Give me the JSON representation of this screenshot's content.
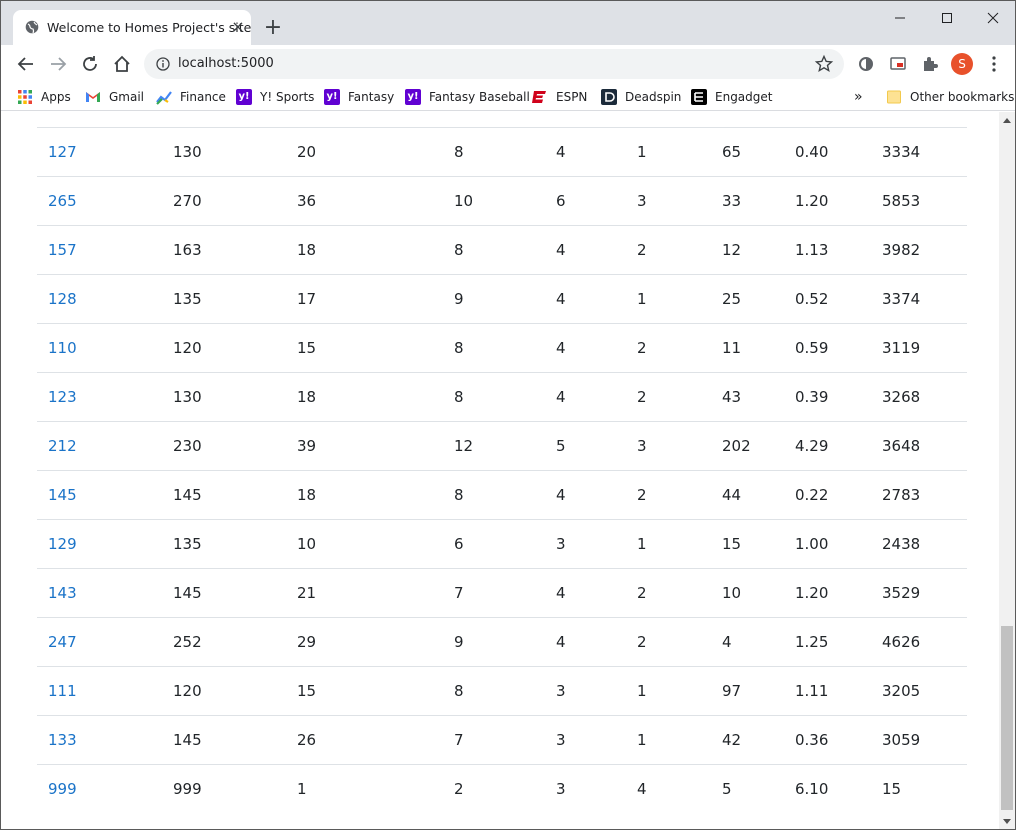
{
  "browser": {
    "tab_title": "Welcome to Homes Project's site",
    "url": "localhost:5000",
    "profile_initial": "S",
    "accent_color": "#1a73c8",
    "bookmarks": [
      {
        "label": "Apps",
        "icon": "apps-grid-icon"
      },
      {
        "label": "Gmail",
        "icon": "gmail-icon"
      },
      {
        "label": "Finance",
        "icon": "finance-icon"
      },
      {
        "label": "Y! Sports",
        "icon": "yahoo-icon"
      },
      {
        "label": "Fantasy",
        "icon": "yahoo-icon"
      },
      {
        "label": "Fantasy Baseball",
        "icon": "yahoo-icon"
      },
      {
        "label": "ESPN",
        "icon": "espn-icon"
      },
      {
        "label": "Deadspin",
        "icon": "deadspin-icon"
      },
      {
        "label": "Engadget",
        "icon": "engadget-icon"
      }
    ],
    "other_bookmarks": "Other bookmarks",
    "overflow": "»"
  },
  "table": {
    "rows": [
      [
        "127",
        "130",
        "20",
        "8",
        "4",
        "1",
        "65",
        "0.40",
        "3334"
      ],
      [
        "265",
        "270",
        "36",
        "10",
        "6",
        "3",
        "33",
        "1.20",
        "5853"
      ],
      [
        "157",
        "163",
        "18",
        "8",
        "4",
        "2",
        "12",
        "1.13",
        "3982"
      ],
      [
        "128",
        "135",
        "17",
        "9",
        "4",
        "1",
        "25",
        "0.52",
        "3374"
      ],
      [
        "110",
        "120",
        "15",
        "8",
        "4",
        "2",
        "11",
        "0.59",
        "3119"
      ],
      [
        "123",
        "130",
        "18",
        "8",
        "4",
        "2",
        "43",
        "0.39",
        "3268"
      ],
      [
        "212",
        "230",
        "39",
        "12",
        "5",
        "3",
        "202",
        "4.29",
        "3648"
      ],
      [
        "145",
        "145",
        "18",
        "8",
        "4",
        "2",
        "44",
        "0.22",
        "2783"
      ],
      [
        "129",
        "135",
        "10",
        "6",
        "3",
        "1",
        "15",
        "1.00",
        "2438"
      ],
      [
        "143",
        "145",
        "21",
        "7",
        "4",
        "2",
        "10",
        "1.20",
        "3529"
      ],
      [
        "247",
        "252",
        "29",
        "9",
        "4",
        "2",
        "4",
        "1.25",
        "4626"
      ],
      [
        "111",
        "120",
        "15",
        "8",
        "3",
        "1",
        "97",
        "1.11",
        "3205"
      ],
      [
        "133",
        "145",
        "26",
        "7",
        "3",
        "1",
        "42",
        "0.36",
        "3059"
      ],
      [
        "999",
        "999",
        "1",
        "2",
        "3",
        "4",
        "5",
        "6.10",
        "15"
      ]
    ]
  }
}
